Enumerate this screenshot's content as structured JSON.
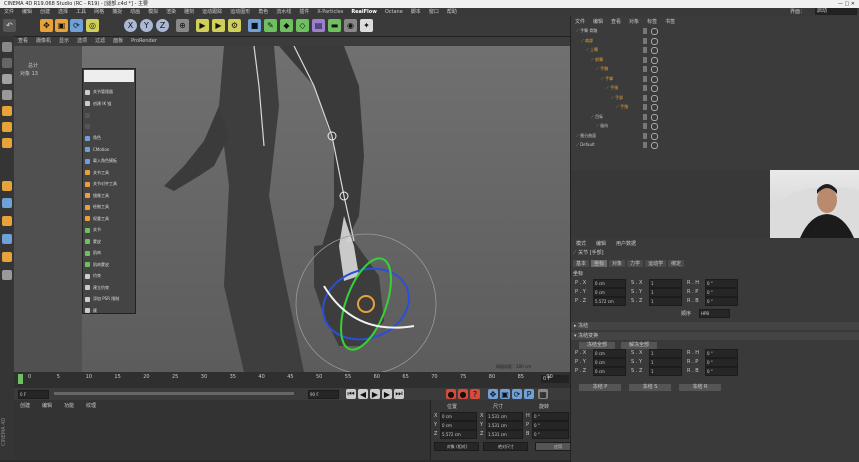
{
  "titlebar": {
    "title": "CINEMA 4D R19.068 Studio (RC - R19) - [腿部.c4d *] - 主要",
    "controls": "— □ ✕"
  },
  "menu": {
    "items": [
      "文件",
      "编辑",
      "创建",
      "选择",
      "工具",
      "网格",
      "捕捉",
      "动画",
      "模拟",
      "渲染",
      "雕刻",
      "运动跟踪",
      "运动图形",
      "角色",
      "流水线",
      "插件",
      "X-Particles",
      "RealFlow",
      "Octane",
      "脚本",
      "窗口",
      "帮助"
    ],
    "active": "RealFlow",
    "right_a": "界面：",
    "right_b": "启动"
  },
  "viewport": {
    "menu": [
      "查看",
      "摄像机",
      "显示",
      "选项",
      "过滤",
      "面板",
      "ProRender"
    ],
    "stats_a": "总计",
    "stats_b": "对象  13",
    "grid_label": "网格间距：100 cm"
  },
  "context_menu": {
    "items": [
      "关节管理器",
      "创建 IK 链",
      "",
      "",
      "角色",
      "CMotion",
      "载入角色模板",
      "关节工具",
      "关节对齐工具",
      "镜像工具",
      "绘制工具",
      "权重工具",
      "关节",
      "蒙皮",
      "肌肉",
      "肌肉蒙皮",
      "约束",
      "建立约束",
      "添加 PSR 限制",
      "簇"
    ]
  },
  "timeline": {
    "ticks": [
      "0",
      "5",
      "10",
      "15",
      "20",
      "25",
      "30",
      "35",
      "40",
      "45",
      "50",
      "55",
      "60",
      "65",
      "70",
      "75",
      "80",
      "85",
      "90"
    ],
    "frame_end": "0 F",
    "start_field": "0 F",
    "end_field": "90 F"
  },
  "materials": {
    "menu": [
      "创建",
      "编辑",
      "功能",
      "纹理"
    ]
  },
  "coords": {
    "headers": [
      "位置",
      "尺寸",
      "旋转"
    ],
    "rows": [
      [
        "X",
        "0 cm",
        "X",
        "1.531 cm",
        "H",
        "0 °"
      ],
      [
        "Y",
        "0 cm",
        "Y",
        "1.531 cm",
        "P",
        "0 °"
      ],
      [
        "Z",
        "5.572 cm",
        "Z",
        "1.531 cm",
        "B",
        "0 °"
      ]
    ],
    "mode_a": "对象 (相对)",
    "mode_b": "绝对尺寸",
    "apply": "应用"
  },
  "object_manager": {
    "menu": [
      "文件",
      "编辑",
      "查看",
      "对象",
      "标签",
      "书签"
    ],
    "rows": [
      {
        "name": "手臂 骨骼",
        "indent": 1,
        "color": "#c9c9c9"
      },
      {
        "name": "肩部",
        "indent": 2,
        "color": "#e8a23a"
      },
      {
        "name": "上臂",
        "indent": 3,
        "color": "#e8a23a"
      },
      {
        "name": "前臂",
        "indent": 4,
        "color": "#e8a23a"
      },
      {
        "name": "手腕",
        "indent": 5,
        "color": "#e8a23a"
      },
      {
        "name": "手掌",
        "indent": 6,
        "color": "#e8a23a"
      },
      {
        "name": "手指",
        "indent": 7,
        "color": "#e8a23a"
      },
      {
        "name": "手部",
        "indent": 8,
        "color": "#e8a23a"
      },
      {
        "name": "手指",
        "indent": 9,
        "color": "#e8a23a"
      },
      {
        "name": "目标",
        "indent": 4,
        "color": "#c9c9c9"
      },
      {
        "name": "极向",
        "indent": 5,
        "color": "#c9c9c9"
      },
      {
        "name": "细分曲面",
        "indent": 1,
        "color": "#c9c9c9"
      },
      {
        "name": "Default",
        "indent": 1,
        "color": "#c9c9c9"
      }
    ]
  },
  "attributes": {
    "menu": [
      "模式",
      "编辑",
      "用户数据"
    ],
    "object_title": "关节 [手部]",
    "tabs": [
      "基本",
      "坐标",
      "对象",
      "力学",
      "运动学",
      "绑定"
    ],
    "active_tab": "坐标",
    "section": "坐标",
    "rows": [
      [
        "P . X",
        "0 cm",
        "S . X",
        "1",
        "R . H",
        "0 °"
      ],
      [
        "P . Y",
        "0 cm",
        "S . Y",
        "1",
        "R . P",
        "0 °"
      ],
      [
        "P . Z",
        "5.572 cm",
        "S . Z",
        "1",
        "R . B",
        "0 °"
      ]
    ],
    "order_label": "顺序",
    "order_value": "HPB",
    "frozen": "冻结",
    "freeze_section": "冻结变换",
    "btn_all": "冻结全部",
    "btn_release": "解冻全部",
    "frozen_rows": [
      [
        "P . X",
        "0 cm",
        "S . X",
        "1",
        "R . H",
        "0 °"
      ],
      [
        "P . Y",
        "0 cm",
        "S . Y",
        "1",
        "R . P",
        "0 °"
      ],
      [
        "P . Z",
        "0 cm",
        "S . Z",
        "1",
        "R . B",
        "0 °"
      ]
    ],
    "btns": [
      "冻结 P",
      "冻结 S",
      "冻结 R"
    ]
  },
  "sidebar_label": "CINEMA 4D"
}
